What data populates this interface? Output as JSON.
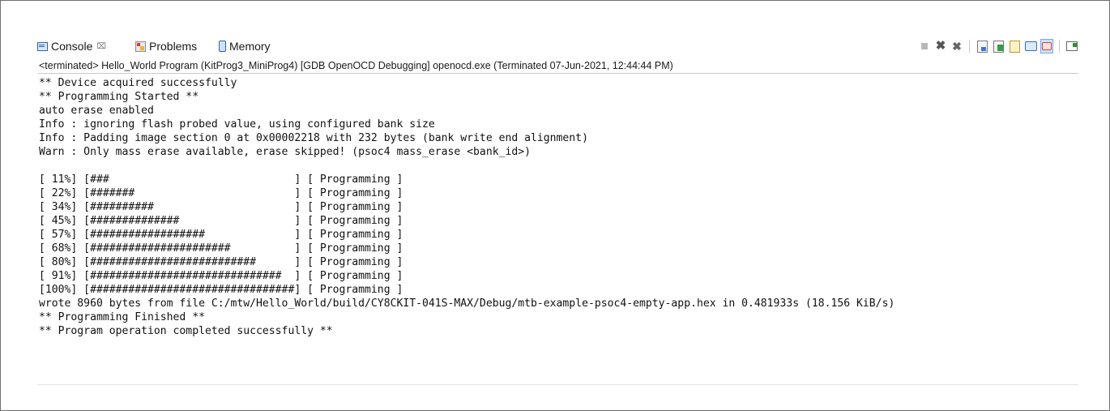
{
  "tabs": [
    {
      "label": "Console",
      "close_glyph": "⌧",
      "icon": "console-icon"
    },
    {
      "label": "Problems",
      "icon": "problems-icon"
    },
    {
      "label": "Memory",
      "icon": "memory-icon"
    }
  ],
  "toolbar": {
    "icons": [
      "terminate-icon",
      "remove-launch-icon",
      "remove-all-terminated-icon",
      "scroll-lock-icon",
      "word-wrap-icon",
      "show-on-stdout-icon",
      "show-on-stderr-icon",
      "display-console-icon",
      "open-console-icon"
    ]
  },
  "status_line": "<terminated> Hello_World Program (KitProg3_MiniProg4) [GDB OpenOCD Debugging] openocd.exe (Terminated 07-Jun-2021, 12:44:44 PM)",
  "console_lines": [
    "** Device acquired successfully",
    "** Programming Started **",
    "auto erase enabled",
    "Info : ignoring flash probed value, using configured bank size",
    "Info : Padding image section 0 at 0x00002218 with 232 bytes (bank write end alignment)",
    "Warn : Only mass erase available, erase skipped! (psoc4 mass_erase <bank_id>)",
    "",
    "[ 11%] [###                             ] [ Programming ]",
    "[ 22%] [#######                         ] [ Programming ]",
    "[ 34%] [##########                      ] [ Programming ]",
    "[ 45%] [##############                  ] [ Programming ]",
    "[ 57%] [##################              ] [ Programming ]",
    "[ 68%] [######################          ] [ Programming ]",
    "[ 80%] [##########################      ] [ Programming ]",
    "[ 91%] [##############################  ] [ Programming ]",
    "[100%] [################################] [ Programming ]",
    "wrote 8960 bytes from file C:/mtw/Hello_World/build/CY8CKIT-041S-MAX/Debug/mtb-example-psoc4-empty-app.hex in 0.481933s (18.156 KiB/s)",
    "** Programming Finished **",
    "** Program operation completed successfully **"
  ]
}
